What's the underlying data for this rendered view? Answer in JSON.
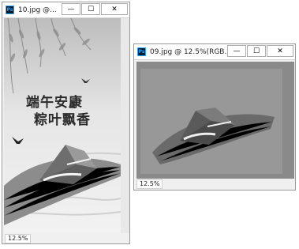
{
  "window_a": {
    "app_badge": "Ps",
    "title": "10.jpg @...",
    "zoom": "12.5%",
    "poster_line1": "端午安康",
    "poster_line2": "粽叶飘香"
  },
  "window_b": {
    "app_badge": "Ps",
    "title": "09.jpg @ 12.5%(RGB...",
    "zoom": "12.5%"
  },
  "controls": {
    "minimize": "—",
    "maximize": "☐",
    "close": "✕"
  }
}
